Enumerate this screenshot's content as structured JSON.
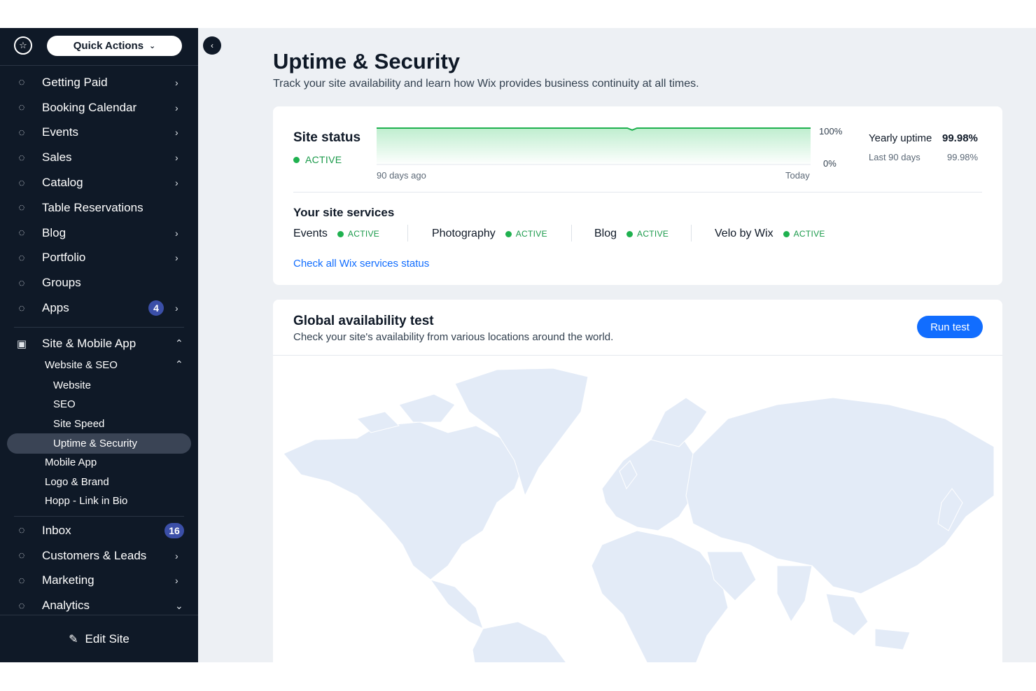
{
  "sidebar": {
    "quick_actions": "Quick Actions",
    "items": [
      {
        "label": "Getting Paid",
        "icon": "receipt-icon",
        "arrow": "›"
      },
      {
        "label": "Booking Calendar",
        "icon": "calendar-icon",
        "arrow": "›"
      },
      {
        "label": "Events",
        "icon": "calendar-event-icon",
        "arrow": "›"
      },
      {
        "label": "Sales",
        "icon": "dollar-icon",
        "arrow": "›"
      },
      {
        "label": "Catalog",
        "icon": "diamond-icon",
        "arrow": "›"
      },
      {
        "label": "Table Reservations",
        "icon": "table-icon",
        "arrow": ""
      },
      {
        "label": "Blog",
        "icon": "pen-nib-icon",
        "arrow": "›"
      },
      {
        "label": "Portfolio",
        "icon": "portfolio-icon",
        "arrow": "›"
      },
      {
        "label": "Groups",
        "icon": "groups-icon",
        "arrow": ""
      },
      {
        "label": "Apps",
        "icon": "apps-icon",
        "arrow": "›",
        "badge": "4"
      }
    ],
    "site_mobile": {
      "label": "Site & Mobile App",
      "icon": "devices-icon",
      "arrow": "⌃"
    },
    "website_seo": {
      "label": "Website & SEO",
      "arrow": "⌃"
    },
    "sub_items": [
      "Website",
      "SEO",
      "Site Speed",
      "Uptime & Security"
    ],
    "more_items": [
      "Mobile App",
      "Logo & Brand",
      "Hopp - Link in Bio"
    ],
    "bottom_items": [
      {
        "label": "Inbox",
        "icon": "inbox-icon",
        "badge": "16"
      },
      {
        "label": "Customers & Leads",
        "icon": "people-icon",
        "arrow": "›"
      },
      {
        "label": "Marketing",
        "icon": "megaphone-icon",
        "arrow": "›"
      },
      {
        "label": "Analytics",
        "icon": "chart-line-icon",
        "arrow": "⌄"
      }
    ],
    "edit_site": "Edit Site"
  },
  "header": {
    "title": "Uptime & Security",
    "subtitle": "Track your site availability and learn how Wix provides business continuity at all times."
  },
  "site_status": {
    "title": "Site status",
    "status": "ACTIVE",
    "axis_left": "90 days ago",
    "axis_right": "Today",
    "y_top": "100%",
    "y_bottom": "0%",
    "yearly_label": "Yearly uptime",
    "yearly_value": "99.98%",
    "last90_label": "Last 90 days",
    "last90_value": "99.98%"
  },
  "chart_data": {
    "type": "area",
    "x": [
      0,
      20,
      40,
      47,
      52,
      53,
      54,
      60,
      80,
      90
    ],
    "values": [
      100,
      100,
      100,
      100,
      100,
      99.5,
      100,
      100,
      100,
      100
    ],
    "ylim": [
      0,
      100
    ],
    "xlabel": "",
    "ylabel": "",
    "grid": false,
    "colors": {
      "line": "#1fb14f",
      "fill": "#c9f0d6"
    }
  },
  "services": {
    "title": "Your site services",
    "items": [
      {
        "name": "Events",
        "status": "ACTIVE"
      },
      {
        "name": "Photography",
        "status": "ACTIVE"
      },
      {
        "name": "Blog",
        "status": "ACTIVE"
      },
      {
        "name": "Velo by Wix",
        "status": "ACTIVE"
      }
    ],
    "link": "Check all Wix services status"
  },
  "global_test": {
    "title": "Global availability test",
    "subtitle": "Check your site's availability from various locations around the world.",
    "run_button": "Run test"
  }
}
